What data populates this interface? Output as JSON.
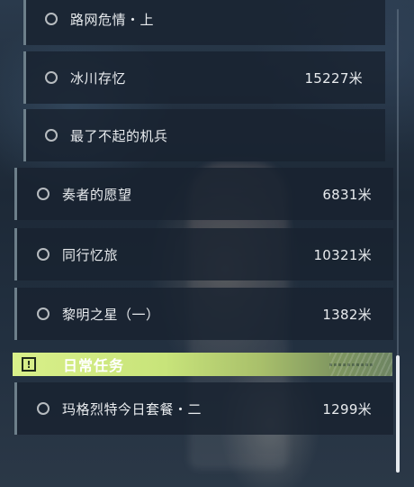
{
  "quests": [
    {
      "name": "路网危情・上",
      "distance": ""
    },
    {
      "name": "冰川存忆",
      "distance": "15227米"
    },
    {
      "name": "最了不起的机兵",
      "distance": ""
    },
    {
      "name": "奏者的愿望",
      "distance": "6831米"
    },
    {
      "name": "同行忆旅",
      "distance": "10321米"
    },
    {
      "name": "黎明之星（一）",
      "distance": "1382米"
    }
  ],
  "section": {
    "title": "日常任务",
    "icon": "exclamation-box-icon"
  },
  "daily_quests": [
    {
      "name": "玛格烈特今日套餐・二",
      "distance": "1299米"
    }
  ],
  "colors": {
    "section_header": "#d9f08a",
    "card_bg": "#182230",
    "card_border": "#6d7f8a"
  }
}
